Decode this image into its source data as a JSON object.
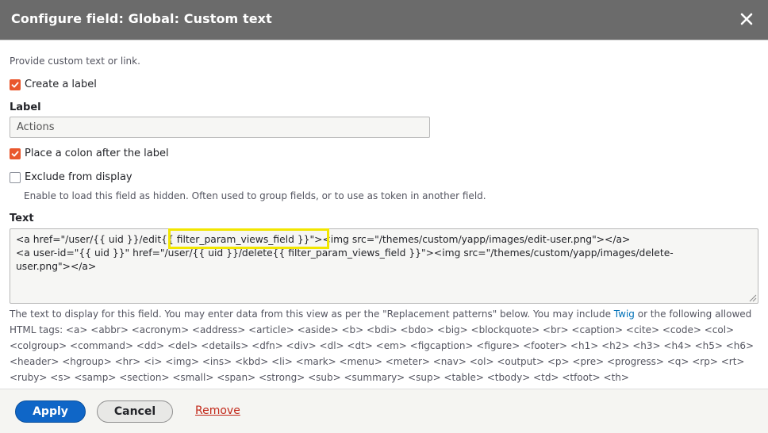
{
  "dialog": {
    "title": "Configure field: Global: Custom text",
    "close_icon": "close-icon"
  },
  "form": {
    "description": "Provide custom text or link.",
    "create_label": {
      "text": "Create a label",
      "checked": true
    },
    "label": {
      "title": "Label",
      "value": "Actions"
    },
    "colon": {
      "text": "Place a colon after the label",
      "checked": true
    },
    "exclude": {
      "text": "Exclude from display",
      "checked": false,
      "hint": "Enable to load this field as hidden. Often used to group fields, or to use as token in another field."
    },
    "text_field": {
      "title": "Text",
      "value": "<a href=\"/user/{{ uid }}/edit{{ filter_param_views_field }}\"><img src=\"/themes/custom/yapp/images/edit-user.png\"></a>\n<a user-id=\"{{ uid }}\" href=\"/user/{{ uid }}/delete{{ filter_param_views_field }}\"><img src=\"/themes/custom/yapp/images/delete-\nuser.png\"></a>"
    },
    "help": {
      "before_link": "The text to display for this field. You may enter data from this view as per the \"Replacement patterns\" below. You may include ",
      "link": "Twig",
      "after_link": " or the following allowed HTML tags: <a> <abbr> <acronym> <address> <article> <aside> <b> <bdi> <bdo> <big> <blockquote> <br> <caption> <cite> <code> <col> <colgroup> <command> <dd> <del> <details> <dfn> <div> <dl> <dt> <em> <figcaption> <figure> <footer> <h1> <h2> <h3> <h4> <h5> <h6> <header> <hgroup> <hr> <i> <img> <ins> <kbd> <li> <mark> <menu> <meter> <nav> <ol> <output> <p> <pre> <progress> <q> <rp> <rt> <ruby> <s> <samp> <section> <small> <span> <strong> <sub> <summary> <sup> <table> <tbody> <td> <tfoot> <th>"
    }
  },
  "footer": {
    "apply_label": "Apply",
    "cancel_label": "Cancel",
    "remove_label": "Remove"
  },
  "colors": {
    "titlebar": "#6b6b6b",
    "checkbox_checked": "#e9572d",
    "primary_button": "#0f66c7",
    "link": "#0071b8",
    "remove_link": "#c2291a",
    "highlight": "#f2e600"
  }
}
